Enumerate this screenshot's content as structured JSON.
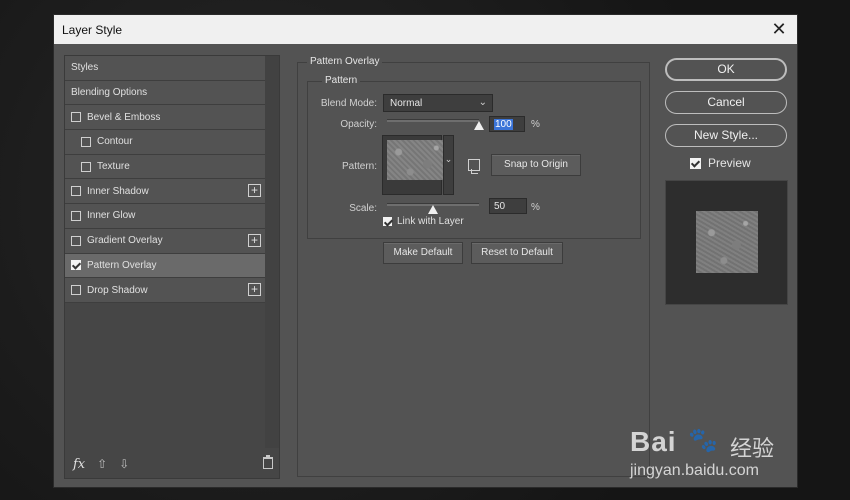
{
  "dialog": {
    "title": "Layer Style",
    "close_icon": "close-icon"
  },
  "styles_panel": {
    "items": [
      {
        "label": "Styles",
        "checkbox": false,
        "checked": false,
        "indent": false,
        "plus": false,
        "selected": false
      },
      {
        "label": "Blending Options",
        "checkbox": false,
        "checked": false,
        "indent": false,
        "plus": false,
        "selected": false
      },
      {
        "label": "Bevel & Emboss",
        "checkbox": true,
        "checked": false,
        "indent": false,
        "plus": false,
        "selected": false
      },
      {
        "label": "Contour",
        "checkbox": true,
        "checked": false,
        "indent": true,
        "plus": false,
        "selected": false
      },
      {
        "label": "Texture",
        "checkbox": true,
        "checked": false,
        "indent": true,
        "plus": false,
        "selected": false
      },
      {
        "label": "Inner Shadow",
        "checkbox": true,
        "checked": false,
        "indent": false,
        "plus": true,
        "selected": false
      },
      {
        "label": "Inner Glow",
        "checkbox": true,
        "checked": false,
        "indent": false,
        "plus": false,
        "selected": false
      },
      {
        "label": "Gradient Overlay",
        "checkbox": true,
        "checked": false,
        "indent": false,
        "plus": true,
        "selected": false
      },
      {
        "label": "Pattern Overlay",
        "checkbox": true,
        "checked": true,
        "indent": false,
        "plus": false,
        "selected": true
      },
      {
        "label": "Drop Shadow",
        "checkbox": true,
        "checked": false,
        "indent": false,
        "plus": true,
        "selected": false
      }
    ],
    "footer": {
      "fx_label": "fx"
    }
  },
  "pattern_overlay": {
    "section_title": "Pattern Overlay",
    "group_title": "Pattern",
    "blend_mode_label": "Blend Mode:",
    "blend_mode_value": "Normal",
    "opacity_label": "Opacity:",
    "opacity_value": "100",
    "opacity_unit": "%",
    "opacity_level": 1.0,
    "pattern_label": "Pattern:",
    "snap_button": "Snap to Origin",
    "scale_label": "Scale:",
    "scale_value": "50",
    "scale_unit": "%",
    "scale_level": 0.5,
    "link_label": "Link with Layer",
    "link_checked": true,
    "make_default": "Make Default",
    "reset_default": "Reset to Default"
  },
  "actions": {
    "ok": "OK",
    "cancel": "Cancel",
    "new_style": "New Style...",
    "preview_label": "Preview",
    "preview_checked": true
  },
  "watermark": {
    "logo_text": "Bai",
    "logo_cn": "经验",
    "url": "jingyan.baidu.com"
  }
}
